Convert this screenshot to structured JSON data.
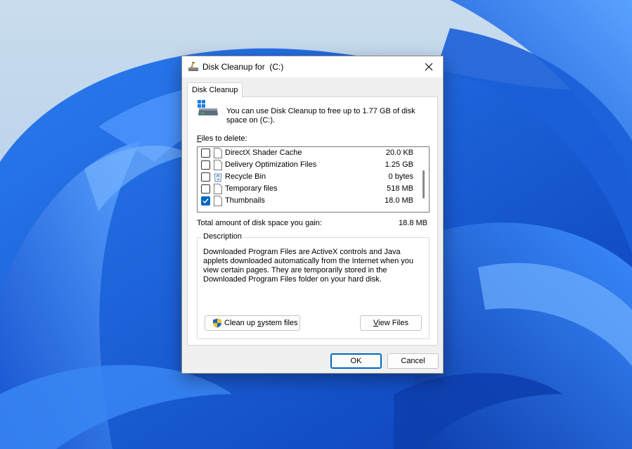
{
  "window": {
    "title": "Disk Cleanup for  (C:)",
    "title_icon": "disk-cleanup-icon",
    "close_icon": "close-icon"
  },
  "tab": {
    "label": "Disk Cleanup"
  },
  "info": {
    "icon": "windows-drive-icon",
    "text": "You can use Disk Cleanup to free up to 1.77 GB of disk space on  (C:)."
  },
  "files_to_delete": {
    "label_accel": "F",
    "label_rest": "iles to delete:",
    "items": [
      {
        "name": "DirectX Shader Cache",
        "size": "20.0 KB",
        "checked": false,
        "icon": "file-icon"
      },
      {
        "name": "Delivery Optimization Files",
        "size": "1.25 GB",
        "checked": false,
        "icon": "file-icon"
      },
      {
        "name": "Recycle Bin",
        "size": "0 bytes",
        "checked": false,
        "icon": "recycle-bin-icon"
      },
      {
        "name": "Temporary files",
        "size": "518 MB",
        "checked": false,
        "icon": "file-icon"
      },
      {
        "name": "Thumbnails",
        "size": "18.0 MB",
        "checked": true,
        "icon": "file-icon"
      }
    ]
  },
  "total": {
    "label": "Total amount of disk space you gain:",
    "value": "18.8 MB"
  },
  "description": {
    "title": "Description",
    "text": "Downloaded Program Files are ActiveX controls and Java applets downloaded automatically from the Internet when you view certain pages. They are temporarily stored in the Downloaded Program Files folder on your hard disk."
  },
  "buttons": {
    "cleanup_pre": "Clean up ",
    "cleanup_accel": "s",
    "cleanup_post": "ystem files",
    "view_accel": "V",
    "view_rest": "iew Files",
    "ok": "OK",
    "cancel": "Cancel"
  },
  "colors": {
    "accent": "#0067c0",
    "dialog_bg": "#f0f0f0",
    "wallpaper_blue": "#1a5fd6"
  }
}
